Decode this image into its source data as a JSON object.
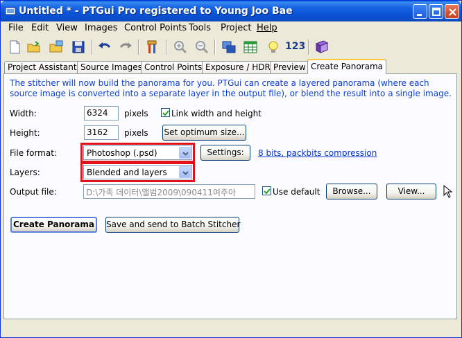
{
  "window": {
    "title": "Untitled * - PTGui Pro registered to Young Joo Bae"
  },
  "menu": [
    "File",
    "Edit",
    "View",
    "Images",
    "Control Points",
    "Tools",
    "Project",
    "Help"
  ],
  "toolbar": {
    "counter_label": "123"
  },
  "tabs": [
    {
      "label": "Project Assistant"
    },
    {
      "label": "Source Images"
    },
    {
      "label": "Control Points"
    },
    {
      "label": "Exposure / HDR"
    },
    {
      "label": "Preview"
    },
    {
      "label": "Create Panorama"
    }
  ],
  "panel": {
    "info_text": "The stitcher will now build the panorama for you. PTGui can create a layered panorama (where each source image is converted into a separate layer in the output file), or blend the result into a single image.",
    "width_label": "Width:",
    "width_value": "6324",
    "width_unit": "pixels",
    "link_label": "Link width and height",
    "link_checked": true,
    "height_label": "Height:",
    "height_value": "3162",
    "height_unit": "pixels",
    "optimum_button": "Set optimum size...",
    "format_label": "File format:",
    "format_value": "Photoshop (.psd)",
    "settings_button": "Settings:",
    "settings_link": "8 bits, packbits compression",
    "layers_label": "Layers:",
    "layers_value": "Blended and layers",
    "output_label": "Output file:",
    "output_value": "D:\\가족 데이터\\앨범2009\\090411여주아",
    "use_default_label": "Use default",
    "use_default_checked": true,
    "browse_button": "Browse...",
    "view_button": "View...",
    "create_button": "Create Panorama",
    "batch_button": "Save and send to Batch Stitcher"
  },
  "colors": {
    "highlight": "#e2121b",
    "info_text": "#0b3fd2",
    "link": "#0033cc"
  }
}
